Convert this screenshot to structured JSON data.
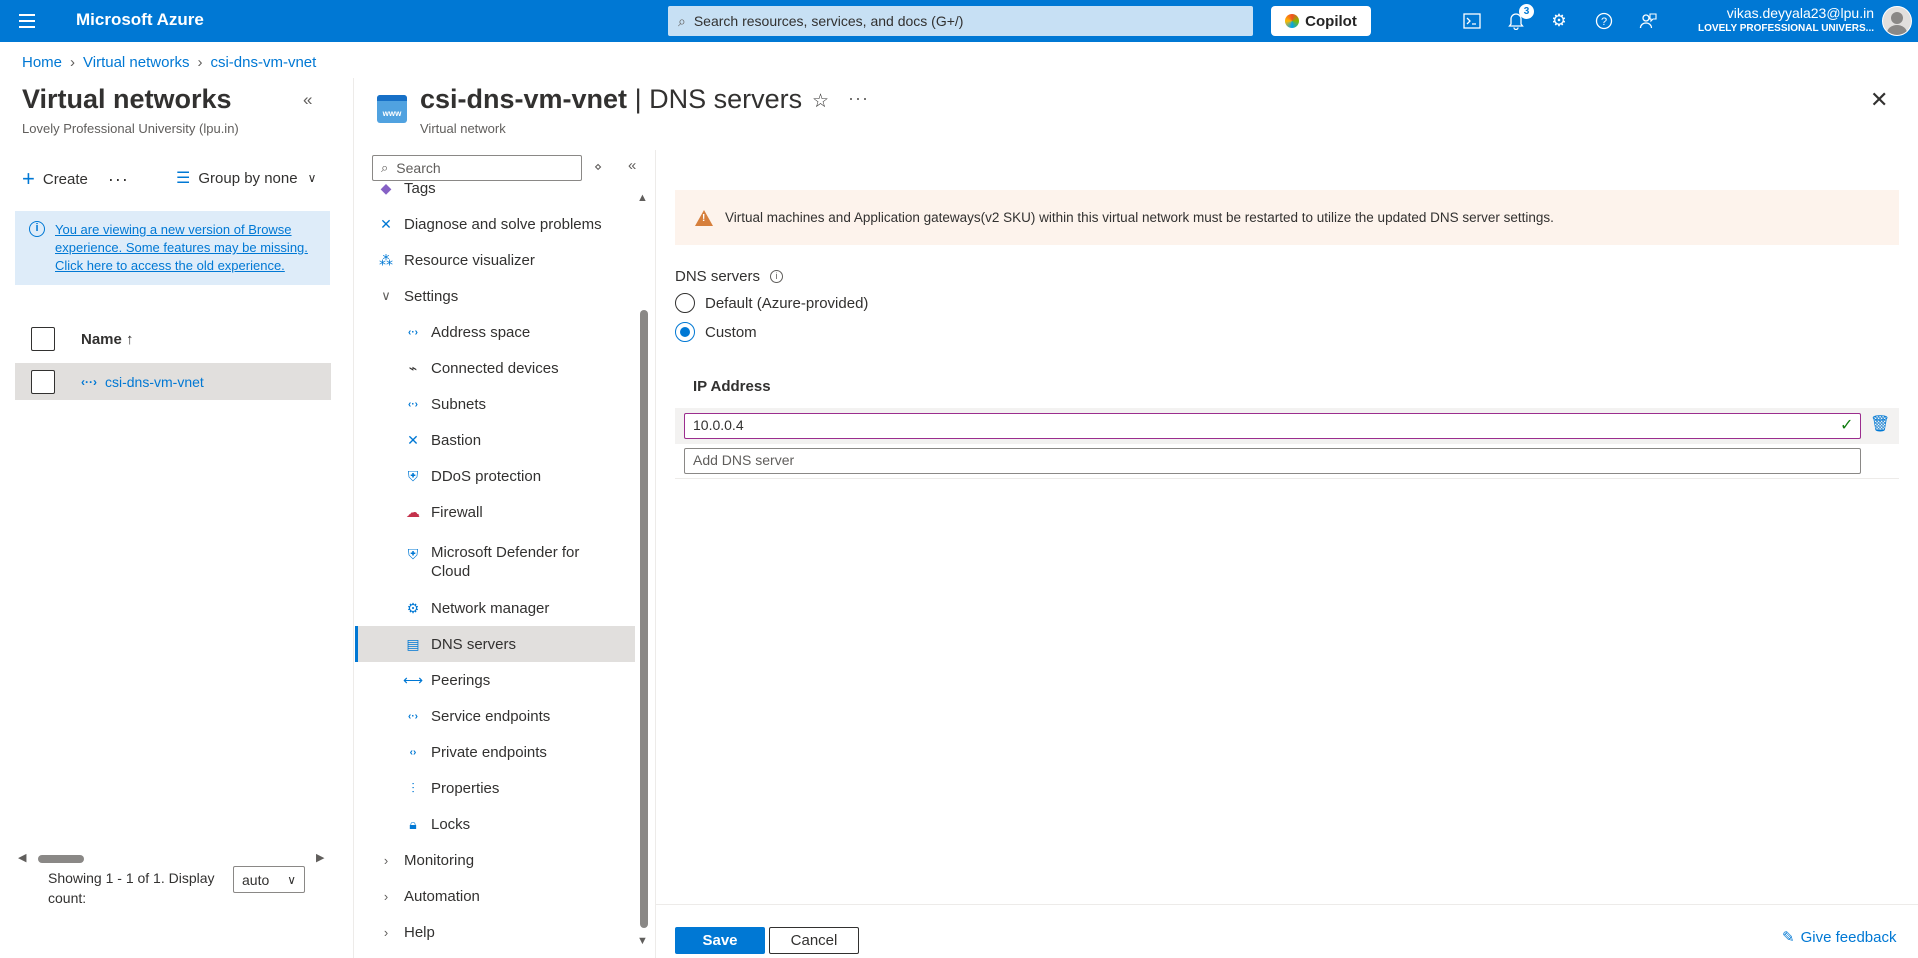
{
  "topbar": {
    "brand": "Microsoft Azure",
    "search_placeholder": "Search resources, services, and docs (G+/)",
    "copilot_label": "Copilot",
    "notification_count": "3",
    "user_email": "vikas.deyyala23@lpu.in",
    "user_org": "LOVELY PROFESSIONAL UNIVERS..."
  },
  "breadcrumb": [
    "Home",
    "Virtual networks",
    "csi-dns-vm-vnet"
  ],
  "left": {
    "title": "Virtual networks",
    "subtitle": "Lovely Professional University (lpu.in)",
    "create_label": "Create",
    "more_label": "···",
    "groupby_label": "Group by none",
    "info_text": "You are viewing a new version of Browse experience. Some features may be missing. Click here to access the old experience.",
    "column_name": "Name ↑",
    "rows": [
      {
        "name": "csi-dns-vm-vnet"
      }
    ],
    "paging_text": "Showing 1 - 1 of 1. Display count:",
    "display_count": "auto"
  },
  "blade": {
    "title_resource": "csi-dns-vm-vnet",
    "title_separator": " | ",
    "title_page": "DNS servers",
    "subtitle": "Virtual network",
    "icon_text": "www"
  },
  "menu": {
    "search_placeholder": "Search",
    "items": [
      {
        "label": "Tags",
        "icon": "tag-icon"
      },
      {
        "label": "Diagnose and solve problems",
        "icon": "wrench-icon"
      },
      {
        "label": "Resource visualizer",
        "icon": "hierarchy-icon"
      },
      {
        "label": "Settings",
        "icon": "chevron-down-icon"
      },
      {
        "label": "Address space",
        "icon": "vnet-icon"
      },
      {
        "label": "Connected devices",
        "icon": "plug-icon"
      },
      {
        "label": "Subnets",
        "icon": "vnet-icon"
      },
      {
        "label": "Bastion",
        "icon": "bastion-icon"
      },
      {
        "label": "DDoS protection",
        "icon": "shield-icon"
      },
      {
        "label": "Firewall",
        "icon": "firewall-icon"
      },
      {
        "label": "Microsoft Defender for Cloud",
        "icon": "defender-icon"
      },
      {
        "label": "Network manager",
        "icon": "network-manager-icon"
      },
      {
        "label": "DNS servers",
        "icon": "dns-icon"
      },
      {
        "label": "Peerings",
        "icon": "peering-icon"
      },
      {
        "label": "Service endpoints",
        "icon": "service-endpoint-icon"
      },
      {
        "label": "Private endpoints",
        "icon": "private-endpoint-icon"
      },
      {
        "label": "Properties",
        "icon": "properties-icon"
      },
      {
        "label": "Locks",
        "icon": "lock-icon"
      },
      {
        "label": "Monitoring",
        "icon": "chevron-right-icon"
      },
      {
        "label": "Automation",
        "icon": "chevron-right-icon"
      },
      {
        "label": "Help",
        "icon": "chevron-right-icon"
      }
    ]
  },
  "content": {
    "warning": "Virtual machines and Application gateways(v2 SKU) within this virtual network must be restarted to utilize the updated DNS server settings.",
    "dns_label": "DNS servers",
    "option_default": "Default (Azure-provided)",
    "option_custom": "Custom",
    "selected_option": "Custom",
    "ip_header": "IP Address",
    "ip_value": "10.0.0.4",
    "add_placeholder": "Add DNS server"
  },
  "footer": {
    "save": "Save",
    "cancel": "Cancel",
    "feedback": "Give feedback"
  },
  "colors": {
    "accent": "#0078d4",
    "warning_bg": "#fdf3ec",
    "warning_icon": "#d67f3c",
    "valid": "#107c10"
  }
}
